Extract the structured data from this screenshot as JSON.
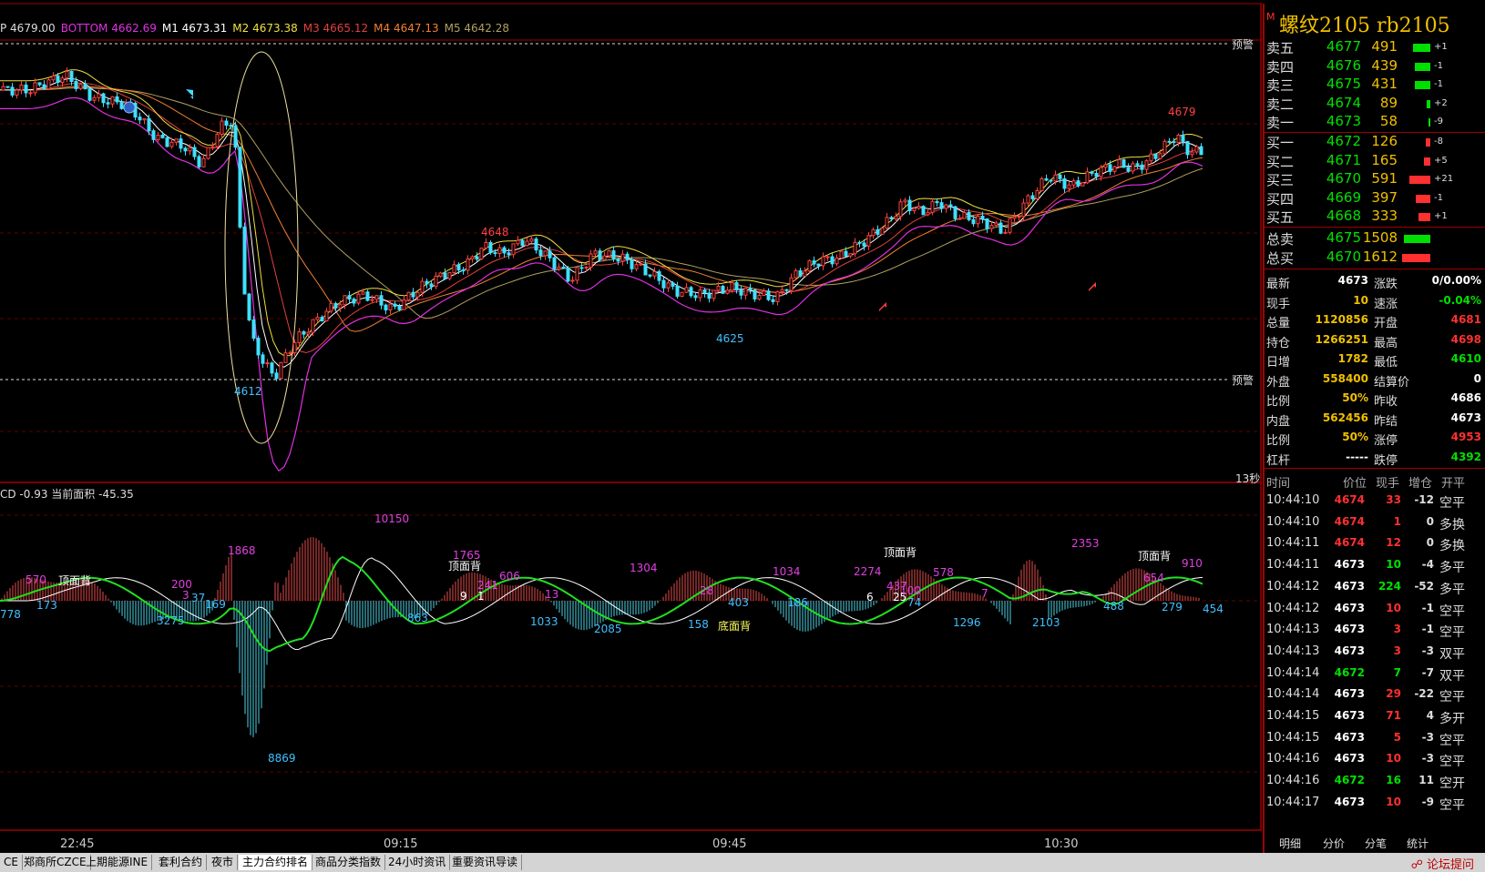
{
  "legend": [
    {
      "text": "P 4679.00",
      "color": "#dddddd"
    },
    {
      "text": "BOTTOM 4662.69",
      "color": "#e030e0"
    },
    {
      "text": "M1 4673.31",
      "color": "#ffffff"
    },
    {
      "text": "M2 4673.38",
      "color": "#f0e040"
    },
    {
      "text": "M3 4665.12",
      "color": "#e04040"
    },
    {
      "text": "M4 4647.13",
      "color": "#f08030"
    },
    {
      "text": "M5 4642.28",
      "color": "#b0a060"
    }
  ],
  "sublegend": "CD -0.93  当前面积  -45.35",
  "warn_label": "预警",
  "timer_label": "13秒",
  "time_axis": [
    "22:45",
    "09:15",
    "09:45",
    "10:30"
  ],
  "price_annotations": [
    {
      "text": "4648",
      "color": "#ff4040"
    },
    {
      "text": "4612",
      "color": "#40c0ff"
    },
    {
      "text": "4625",
      "color": "#40c0ff"
    },
    {
      "text": "4679",
      "color": "#ff4040"
    }
  ],
  "macd_annotations": [
    {
      "text": "570",
      "color": "#e040e0"
    },
    {
      "text": "778",
      "color": "#40c0ff"
    },
    {
      "text": "顶面背",
      "color": "#ffffff"
    },
    {
      "text": "173",
      "color": "#40c0ff"
    },
    {
      "text": "200",
      "color": "#e040e0"
    },
    {
      "text": "3275",
      "color": "#40c0ff"
    },
    {
      "text": "3",
      "color": "#e040e0"
    },
    {
      "text": "37",
      "color": "#40c0ff"
    },
    {
      "text": "169",
      "color": "#40c0ff"
    },
    {
      "text": "1868",
      "color": "#e040e0"
    },
    {
      "text": "10150",
      "color": "#e040e0"
    },
    {
      "text": "8869",
      "color": "#40c0ff"
    },
    {
      "text": "1765",
      "color": "#e040e0"
    },
    {
      "text": "顶面背",
      "color": "#ffffff"
    },
    {
      "text": "241",
      "color": "#e040e0"
    },
    {
      "text": "606",
      "color": "#e040e0"
    },
    {
      "text": "9",
      "color": "#ffffff"
    },
    {
      "text": "1",
      "color": "#ffffff"
    },
    {
      "text": "863",
      "color": "#40c0ff"
    },
    {
      "text": "13",
      "color": "#e040e0"
    },
    {
      "text": "1033",
      "color": "#40c0ff"
    },
    {
      "text": "1304",
      "color": "#e040e0"
    },
    {
      "text": "2085",
      "color": "#40c0ff"
    },
    {
      "text": "28",
      "color": "#e040e0"
    },
    {
      "text": "158",
      "color": "#40c0ff"
    },
    {
      "text": "底面背",
      "color": "#ffff60"
    },
    {
      "text": "403",
      "color": "#40c0ff"
    },
    {
      "text": "1034",
      "color": "#e040e0"
    },
    {
      "text": "186",
      "color": "#40c0ff"
    },
    {
      "text": "2274",
      "color": "#e040e0"
    },
    {
      "text": "437",
      "color": "#e040e0"
    },
    {
      "text": "6",
      "color": "#ffffff"
    },
    {
      "text": "25",
      "color": "#ffffff"
    },
    {
      "text": "100",
      "color": "#e040e0"
    },
    {
      "text": "74",
      "color": "#40c0ff"
    },
    {
      "text": "顶面背",
      "color": "#ffffff"
    },
    {
      "text": "578",
      "color": "#e040e0"
    },
    {
      "text": "7",
      "color": "#e040e0"
    },
    {
      "text": "1296",
      "color": "#40c0ff"
    },
    {
      "text": "2103",
      "color": "#40c0ff"
    },
    {
      "text": "2353",
      "color": "#e040e0"
    },
    {
      "text": "488",
      "color": "#40c0ff"
    },
    {
      "text": "顶面背",
      "color": "#ffffff"
    },
    {
      "text": "654",
      "color": "#e040e0"
    },
    {
      "text": "279",
      "color": "#40c0ff"
    },
    {
      "text": "910",
      "color": "#e040e0"
    },
    {
      "text": "454",
      "color": "#40c0ff"
    }
  ],
  "quote": {
    "mark": "M",
    "title": "螺纹2105  rb2105",
    "asks": [
      {
        "label": "卖五",
        "price": "4677",
        "vol": "491",
        "chg": "+1",
        "bar": 0.4
      },
      {
        "label": "卖四",
        "price": "4676",
        "vol": "439",
        "chg": "-1",
        "bar": 0.36
      },
      {
        "label": "卖三",
        "price": "4675",
        "vol": "431",
        "chg": "-1",
        "bar": 0.36
      },
      {
        "label": "卖二",
        "price": "4674",
        "vol": "89",
        "chg": "+2",
        "bar": 0.08
      },
      {
        "label": "卖一",
        "price": "4673",
        "vol": "58",
        "chg": "-9",
        "bar": 0.05
      }
    ],
    "bids": [
      {
        "label": "买一",
        "price": "4672",
        "vol": "126",
        "chg": "-8",
        "bar": 0.1
      },
      {
        "label": "买二",
        "price": "4671",
        "vol": "165",
        "chg": "+5",
        "bar": 0.14
      },
      {
        "label": "买三",
        "price": "4670",
        "vol": "591",
        "chg": "+21",
        "bar": 0.48
      },
      {
        "label": "买四",
        "price": "4669",
        "vol": "397",
        "chg": "-1",
        "bar": 0.33
      },
      {
        "label": "买五",
        "price": "4668",
        "vol": "333",
        "chg": "+1",
        "bar": 0.28
      }
    ],
    "totals": [
      {
        "label": "总卖",
        "price": "4675",
        "vol": "1508",
        "bar": 0.6,
        "color": "#00e000"
      },
      {
        "label": "总买",
        "price": "4670",
        "vol": "1612",
        "bar": 0.65,
        "color": "#ff3030"
      }
    ],
    "stats": [
      {
        "l1": "最新",
        "v1": "4673",
        "v1c": "#ffffff",
        "l2": "涨跌",
        "v2": "0/0.00%",
        "v2c": "#ffffff"
      },
      {
        "l1": "现手",
        "v1": "10",
        "v1c": "#f0c000",
        "l2": "速涨",
        "v2": "-0.04%",
        "v2c": "#00e000"
      },
      {
        "l1": "总量",
        "v1": "1120856",
        "v1c": "#f0c000",
        "l2": "开盘",
        "v2": "4681",
        "v2c": "#ff3030"
      },
      {
        "l1": "持仓",
        "v1": "1266251",
        "v1c": "#f0c000",
        "l2": "最高",
        "v2": "4698",
        "v2c": "#ff3030"
      },
      {
        "l1": "日增",
        "v1": "1782",
        "v1c": "#f0c000",
        "l2": "最低",
        "v2": "4610",
        "v2c": "#00e000"
      },
      {
        "l1": "外盘",
        "v1": "558400",
        "v1c": "#f0c000",
        "l2": "结算价",
        "v2": "0",
        "v2c": "#ffffff"
      },
      {
        "l1": "比例",
        "v1": "50%",
        "v1c": "#f0c000",
        "l2": "昨收",
        "v2": "4686",
        "v2c": "#ffffff"
      },
      {
        "l1": "内盘",
        "v1": "562456",
        "v1c": "#f0c000",
        "l2": "昨结",
        "v2": "4673",
        "v2c": "#ffffff"
      },
      {
        "l1": "比例",
        "v1": "50%",
        "v1c": "#f0c000",
        "l2": "涨停",
        "v2": "4953",
        "v2c": "#ff3030"
      },
      {
        "l1": "杠杆",
        "v1": "-----",
        "v1c": "#ffffff",
        "l2": "跌停",
        "v2": "4392",
        "v2c": "#00e000"
      }
    ],
    "ticks_header": {
      "time": "时间",
      "price": "价位",
      "qty": "现手",
      "chg": "增仓",
      "kind": "开平"
    },
    "ticks": [
      {
        "time": "10:44:10",
        "price": "4674",
        "pc": "#ff3030",
        "qty": "33",
        "qc": "#ff3030",
        "chg": "-12",
        "kind": "空平"
      },
      {
        "time": "10:44:10",
        "price": "4674",
        "pc": "#ff3030",
        "qty": "1",
        "qc": "#ff3030",
        "chg": "0",
        "kind": "多换"
      },
      {
        "time": "10:44:11",
        "price": "4674",
        "pc": "#ff3030",
        "qty": "12",
        "qc": "#ff3030",
        "chg": "0",
        "kind": "多换"
      },
      {
        "time": "10:44:11",
        "price": "4673",
        "pc": "#ffffff",
        "qty": "10",
        "qc": "#00e000",
        "chg": "-4",
        "kind": "多平"
      },
      {
        "time": "10:44:12",
        "price": "4673",
        "pc": "#ffffff",
        "qty": "224",
        "qc": "#00e000",
        "chg": "-52",
        "kind": "多平"
      },
      {
        "time": "10:44:12",
        "price": "4673",
        "pc": "#ffffff",
        "qty": "10",
        "qc": "#ff3030",
        "chg": "-1",
        "kind": "空平"
      },
      {
        "time": "10:44:13",
        "price": "4673",
        "pc": "#ffffff",
        "qty": "3",
        "qc": "#ff3030",
        "chg": "-1",
        "kind": "空平"
      },
      {
        "time": "10:44:13",
        "price": "4673",
        "pc": "#ffffff",
        "qty": "3",
        "qc": "#ff3030",
        "chg": "-3",
        "kind": "双平"
      },
      {
        "time": "10:44:14",
        "price": "4672",
        "pc": "#00e000",
        "qty": "7",
        "qc": "#00e000",
        "chg": "-7",
        "kind": "双平"
      },
      {
        "time": "10:44:14",
        "price": "4673",
        "pc": "#ffffff",
        "qty": "29",
        "qc": "#ff3030",
        "chg": "-22",
        "kind": "空平"
      },
      {
        "time": "10:44:15",
        "price": "4673",
        "pc": "#ffffff",
        "qty": "71",
        "qc": "#ff3030",
        "chg": "4",
        "kind": "多开"
      },
      {
        "time": "10:44:15",
        "price": "4673",
        "pc": "#ffffff",
        "qty": "5",
        "qc": "#ff3030",
        "chg": "-3",
        "kind": "空平"
      },
      {
        "time": "10:44:16",
        "price": "4673",
        "pc": "#ffffff",
        "qty": "10",
        "qc": "#ff3030",
        "chg": "-3",
        "kind": "空平"
      },
      {
        "time": "10:44:16",
        "price": "4672",
        "pc": "#00e000",
        "qty": "16",
        "qc": "#00e000",
        "chg": "11",
        "kind": "空开"
      },
      {
        "time": "10:44:17",
        "price": "4673",
        "pc": "#ffffff",
        "qty": "10",
        "qc": "#ff3030",
        "chg": "-9",
        "kind": "空平"
      }
    ],
    "tabs": [
      "明细",
      "分价",
      "分笔",
      "统计"
    ]
  },
  "bottom_tabs": [
    "CE",
    "郑商所CZCE",
    "上期能源INE",
    "套利合约",
    "夜市",
    "主力合约排名",
    "商品分类指数",
    "24小时资讯",
    "重要资讯导读"
  ],
  "active_tab": 5,
  "forum_link": "论坛提问"
}
